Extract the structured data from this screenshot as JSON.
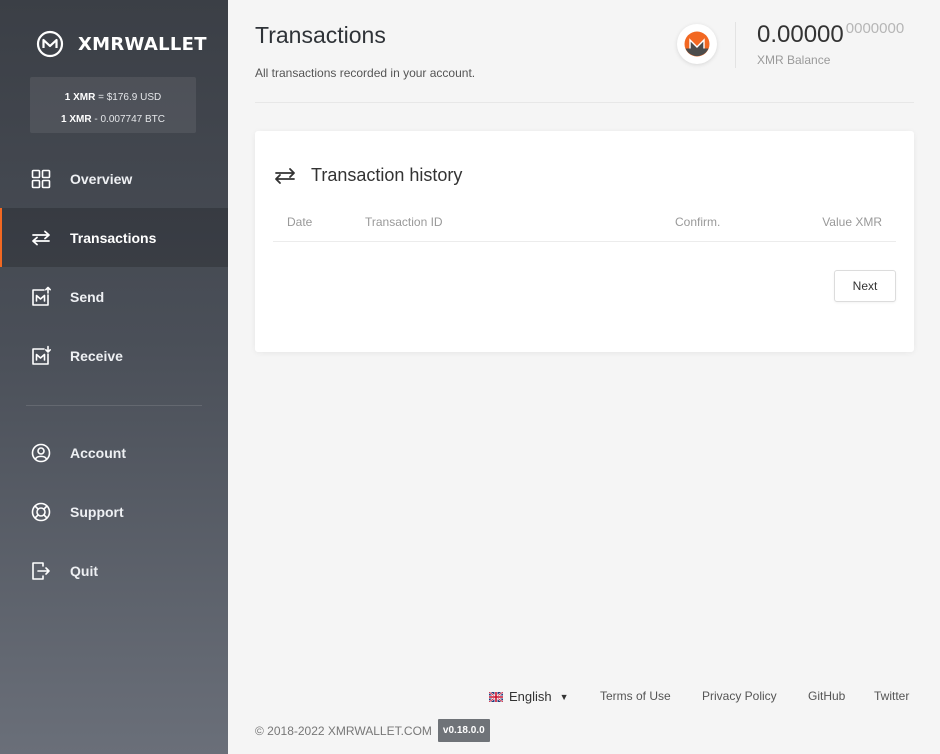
{
  "sidebar": {
    "brand": "XMRWALLET",
    "rates": {
      "usd_lead": "1 XMR",
      "usd_rest": " = $176.9 USD",
      "btc_lead": "1 XMR",
      "btc_rest": " - 0.007747 BTC"
    },
    "nav": [
      {
        "label": "Overview",
        "icon": "grid-icon",
        "active": false
      },
      {
        "label": "Transactions",
        "icon": "swap-arrows-icon",
        "active": true
      },
      {
        "label": "Send",
        "icon": "send-icon",
        "active": false
      },
      {
        "label": "Receive",
        "icon": "receive-icon",
        "active": false
      },
      {
        "label": "Account",
        "icon": "account-icon",
        "active": false
      },
      {
        "label": "Support",
        "icon": "lifebuoy-icon",
        "active": false
      },
      {
        "label": "Quit",
        "icon": "logout-icon",
        "active": false
      }
    ]
  },
  "header": {
    "title": "Transactions",
    "subtitle": "All transactions recorded in your account.",
    "balance_main": "0.00000",
    "balance_fraction": "0000000",
    "balance_label": "XMR Balance"
  },
  "history": {
    "title": "Transaction history",
    "columns": [
      "Date",
      "Transaction ID",
      "Confirm.",
      "Value XMR"
    ],
    "next_label": "Next"
  },
  "footer": {
    "language": "English",
    "links": [
      "Terms of Use",
      "Privacy Policy",
      "GitHub",
      "Twitter"
    ],
    "copyright": "© 2018-2022 XMRWALLET.COM",
    "version": "v0.18.0.0"
  },
  "colors": {
    "accent": "#f26822",
    "sidebar_top": "#3b3f46",
    "sidebar_bottom": "#6a6f79"
  }
}
